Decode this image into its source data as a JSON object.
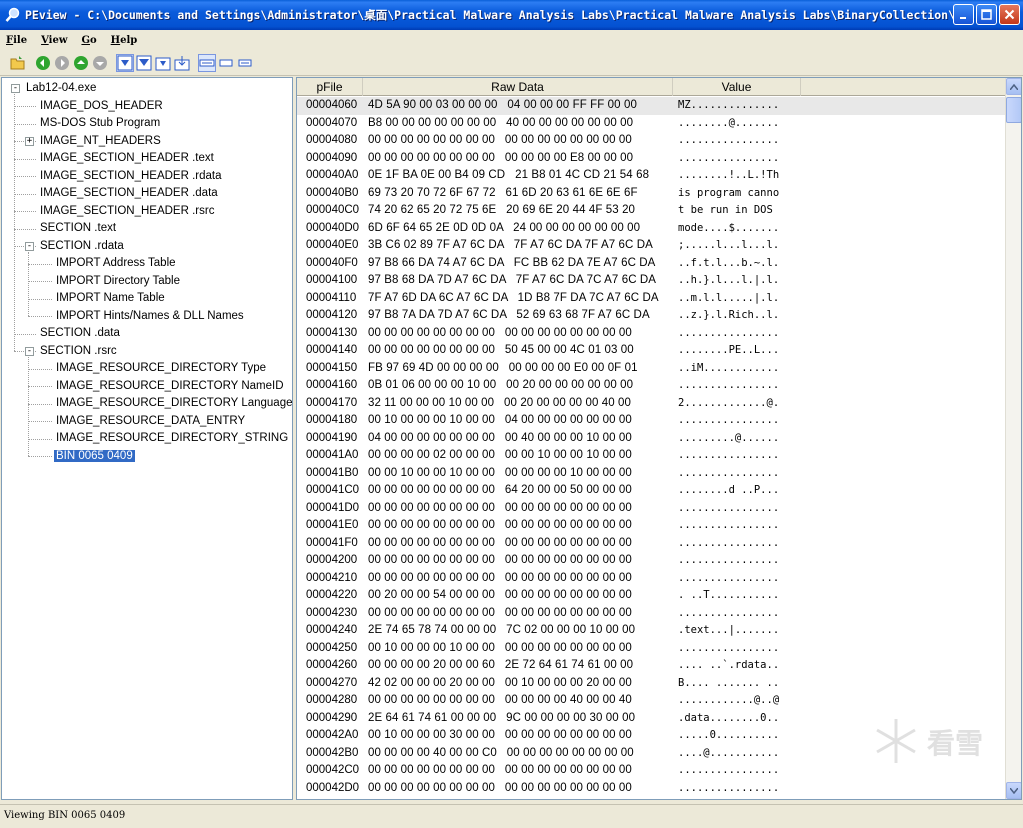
{
  "window": {
    "title": "PEview - C:\\Documents and Settings\\Administrator\\桌面\\Practical Malware Analysis Labs\\Practical Malware Analysis Labs\\BinaryCollection\\C..."
  },
  "menu": [
    {
      "u": "F",
      "rest": "ile"
    },
    {
      "u": "V",
      "rest": "iew"
    },
    {
      "u": "G",
      "rest": "o"
    },
    {
      "u": "H",
      "rest": "elp"
    }
  ],
  "toolbar": {
    "icons": [
      "open-icon",
      "back-icon",
      "forward-icon",
      "previous-icon",
      "next-icon",
      "view-byte-icon",
      "view-word-icon",
      "view-dword-icon",
      "view-qword-icon",
      "hex-mode-icon",
      "list-mode-icon",
      "detail-mode-icon"
    ]
  },
  "tree": {
    "items": [
      {
        "label": "Lab12-04.exe",
        "level": 0,
        "expander": "-"
      },
      {
        "label": "IMAGE_DOS_HEADER",
        "level": 1
      },
      {
        "label": "MS-DOS Stub Program",
        "level": 1
      },
      {
        "label": "IMAGE_NT_HEADERS",
        "level": 1,
        "expander": "+"
      },
      {
        "label": "IMAGE_SECTION_HEADER .text",
        "level": 1
      },
      {
        "label": "IMAGE_SECTION_HEADER .rdata",
        "level": 1
      },
      {
        "label": "IMAGE_SECTION_HEADER .data",
        "level": 1
      },
      {
        "label": "IMAGE_SECTION_HEADER .rsrc",
        "level": 1
      },
      {
        "label": "SECTION .text",
        "level": 1
      },
      {
        "label": "SECTION .rdata",
        "level": 1,
        "expander": "-"
      },
      {
        "label": "IMPORT Address Table",
        "level": 2
      },
      {
        "label": "IMPORT Directory Table",
        "level": 2
      },
      {
        "label": "IMPORT Name Table",
        "level": 2
      },
      {
        "label": "IMPORT Hints/Names & DLL Names",
        "level": 2
      },
      {
        "label": "SECTION .data",
        "level": 1
      },
      {
        "label": "SECTION .rsrc",
        "level": 1,
        "expander": "-"
      },
      {
        "label": "IMAGE_RESOURCE_DIRECTORY Type",
        "level": 2
      },
      {
        "label": "IMAGE_RESOURCE_DIRECTORY NameID",
        "level": 2
      },
      {
        "label": "IMAGE_RESOURCE_DIRECTORY Language",
        "level": 2
      },
      {
        "label": "IMAGE_RESOURCE_DATA_ENTRY",
        "level": 2
      },
      {
        "label": "IMAGE_RESOURCE_DIRECTORY_STRING",
        "level": 2
      },
      {
        "label": "BIN  0065  0409",
        "level": 2,
        "selected": true
      }
    ]
  },
  "hex": {
    "headers": [
      "pFile",
      "Raw Data",
      "Value"
    ],
    "rows": [
      [
        "00004060",
        "4D 5A 90 00 03 00 00 00   04 00 00 00 FF FF 00 00",
        "MZ.............."
      ],
      [
        "00004070",
        "B8 00 00 00 00 00 00 00   40 00 00 00 00 00 00 00",
        "........@......."
      ],
      [
        "00004080",
        "00 00 00 00 00 00 00 00   00 00 00 00 00 00 00 00",
        "................"
      ],
      [
        "00004090",
        "00 00 00 00 00 00 00 00   00 00 00 00 E8 00 00 00",
        "................"
      ],
      [
        "000040A0",
        "0E 1F BA 0E 00 B4 09 CD   21 B8 01 4C CD 21 54 68",
        "........!..L.!Th"
      ],
      [
        "000040B0",
        "69 73 20 70 72 6F 67 72   61 6D 20 63 61 6E 6E 6F",
        "is program canno"
      ],
      [
        "000040C0",
        "74 20 62 65 20 72 75 6E   20 69 6E 20 44 4F 53 20",
        "t be run in DOS "
      ],
      [
        "000040D0",
        "6D 6F 64 65 2E 0D 0D 0A   24 00 00 00 00 00 00 00",
        "mode....$......."
      ],
      [
        "000040E0",
        "3B C6 02 89 7F A7 6C DA   7F A7 6C DA 7F A7 6C DA",
        ";.....l...l...l."
      ],
      [
        "000040F0",
        "97 B8 66 DA 74 A7 6C DA   FC BB 62 DA 7E A7 6C DA",
        "..f.t.l...b.~.l."
      ],
      [
        "00004100",
        "97 B8 68 DA 7D A7 6C DA   7F A7 6C DA 7C A7 6C DA",
        "..h.}.l...l.|.l."
      ],
      [
        "00004110",
        "7F A7 6D DA 6C A7 6C DA   1D B8 7F DA 7C A7 6C DA",
        "..m.l.l.....|.l."
      ],
      [
        "00004120",
        "97 B8 7A DA 7D A7 6C DA   52 69 63 68 7F A7 6C DA",
        "..z.}.l.Rich..l."
      ],
      [
        "00004130",
        "00 00 00 00 00 00 00 00   00 00 00 00 00 00 00 00",
        "................"
      ],
      [
        "00004140",
        "00 00 00 00 00 00 00 00   50 45 00 00 4C 01 03 00",
        "........PE..L..."
      ],
      [
        "00004150",
        "FB 97 69 4D 00 00 00 00   00 00 00 00 E0 00 0F 01",
        "..iM............"
      ],
      [
        "00004160",
        "0B 01 06 00 00 00 10 00   00 20 00 00 00 00 00 00",
        "................"
      ],
      [
        "00004170",
        "32 11 00 00 00 10 00 00   00 20 00 00 00 00 40 00",
        "2.............@."
      ],
      [
        "00004180",
        "00 10 00 00 00 10 00 00   04 00 00 00 00 00 00 00",
        "................"
      ],
      [
        "00004190",
        "04 00 00 00 00 00 00 00   00 40 00 00 00 10 00 00",
        ".........@......"
      ],
      [
        "000041A0",
        "00 00 00 00 02 00 00 00   00 00 10 00 00 10 00 00",
        "................"
      ],
      [
        "000041B0",
        "00 00 10 00 00 10 00 00   00 00 00 00 10 00 00 00",
        "................"
      ],
      [
        "000041C0",
        "00 00 00 00 00 00 00 00   64 20 00 00 50 00 00 00",
        "........d ..P..."
      ],
      [
        "000041D0",
        "00 00 00 00 00 00 00 00   00 00 00 00 00 00 00 00",
        "................"
      ],
      [
        "000041E0",
        "00 00 00 00 00 00 00 00   00 00 00 00 00 00 00 00",
        "................"
      ],
      [
        "000041F0",
        "00 00 00 00 00 00 00 00   00 00 00 00 00 00 00 00",
        "................"
      ],
      [
        "00004200",
        "00 00 00 00 00 00 00 00   00 00 00 00 00 00 00 00",
        "................"
      ],
      [
        "00004210",
        "00 00 00 00 00 00 00 00   00 00 00 00 00 00 00 00",
        "................"
      ],
      [
        "00004220",
        "00 20 00 00 54 00 00 00   00 00 00 00 00 00 00 00",
        ". ..T..........."
      ],
      [
        "00004230",
        "00 00 00 00 00 00 00 00   00 00 00 00 00 00 00 00",
        "................"
      ],
      [
        "00004240",
        "2E 74 65 78 74 00 00 00   7C 02 00 00 00 10 00 00",
        ".text...|......."
      ],
      [
        "00004250",
        "00 10 00 00 00 10 00 00   00 00 00 00 00 00 00 00",
        "................"
      ],
      [
        "00004260",
        "00 00 00 00 20 00 00 60   2E 72 64 61 74 61 00 00",
        ".... ..`.rdata.."
      ],
      [
        "00004270",
        "42 02 00 00 00 20 00 00   00 10 00 00 00 20 00 00",
        "B.... ....... .."
      ],
      [
        "00004280",
        "00 00 00 00 00 00 00 00   00 00 00 00 40 00 00 40",
        "............@..@"
      ],
      [
        "00004290",
        "2E 64 61 74 61 00 00 00   9C 00 00 00 00 30 00 00",
        ".data........0.."
      ],
      [
        "000042A0",
        "00 10 00 00 00 30 00 00   00 00 00 00 00 00 00 00",
        ".....0.........."
      ],
      [
        "000042B0",
        "00 00 00 00 40 00 00 C0   00 00 00 00 00 00 00 00",
        "....@..........."
      ],
      [
        "000042C0",
        "00 00 00 00 00 00 00 00   00 00 00 00 00 00 00 00",
        "................"
      ],
      [
        "000042D0",
        "00 00 00 00 00 00 00 00   00 00 00 00 00 00 00 00",
        "................"
      ]
    ]
  },
  "status": {
    "text": "Viewing BIN  0065  0409"
  },
  "watermark": {
    "text": "看雪"
  }
}
